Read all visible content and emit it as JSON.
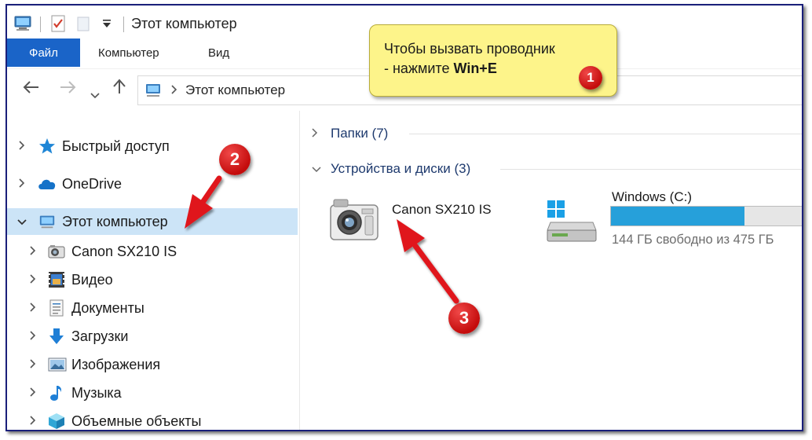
{
  "window": {
    "title": "Этот компьютер"
  },
  "ribbon": {
    "tabs": [
      "Файл",
      "Компьютер",
      "Вид"
    ]
  },
  "address": {
    "path": [
      "Этот компьютер"
    ]
  },
  "sidebar": {
    "items": [
      {
        "label": "Быстрый доступ",
        "icon": "star-icon",
        "level": 0,
        "expanded": false
      },
      {
        "label": "OneDrive",
        "icon": "cloud-icon",
        "level": 0,
        "expanded": false
      },
      {
        "label": "Этот компьютер",
        "icon": "computer-icon",
        "level": 0,
        "expanded": true,
        "selected": true
      },
      {
        "label": "Canon  SX210 IS",
        "icon": "camera-icon",
        "level": 1
      },
      {
        "label": "Видео",
        "icon": "video-icon",
        "level": 1
      },
      {
        "label": "Документы",
        "icon": "document-icon",
        "level": 1
      },
      {
        "label": "Загрузки",
        "icon": "download-icon",
        "level": 1
      },
      {
        "label": "Изображения",
        "icon": "image-icon",
        "level": 1
      },
      {
        "label": "Музыка",
        "icon": "music-icon",
        "level": 1
      },
      {
        "label": "Объемные объекты",
        "icon": "cube-icon",
        "level": 1
      }
    ]
  },
  "content": {
    "groups": [
      {
        "label": "Папки (7)",
        "expanded": false
      },
      {
        "label": "Устройства и диски (3)",
        "expanded": true
      }
    ],
    "devices": [
      {
        "name": "Canon  SX210 IS",
        "icon": "camera-icon"
      },
      {
        "name": "Windows (C:)",
        "icon": "drive-icon",
        "free_text": "144 ГБ свободно из 475 ГБ",
        "used_fraction": 0.697
      }
    ]
  },
  "annotations": {
    "callout_line1": "Чтобы вызвать проводник",
    "callout_line2_prefix": "- нажмите ",
    "callout_line2_keys": "Win+E",
    "badges": [
      "1",
      "2",
      "3"
    ]
  },
  "colors": {
    "accent": "#1a64c8",
    "selection": "#cce4f7",
    "drive_fill": "#26a0da",
    "callout": "#fdf48a",
    "badge": "#d61a1a",
    "arrow": "#e0161c"
  }
}
